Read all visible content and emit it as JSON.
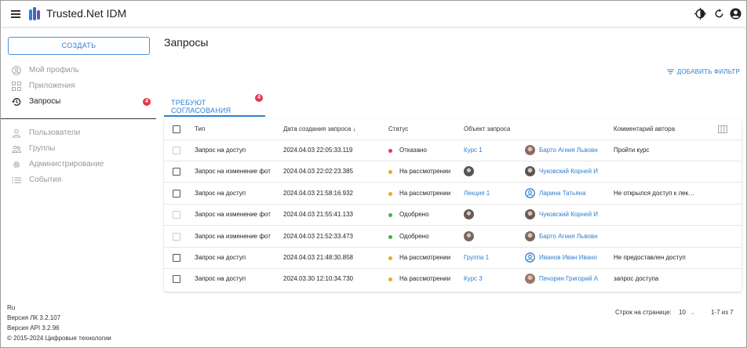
{
  "app": {
    "title": "Trusted.Net IDM"
  },
  "header": {
    "icons": [
      "contrast-icon",
      "refresh-icon",
      "account-icon"
    ]
  },
  "sidebar": {
    "create_label": "СОЗДАТЬ",
    "items": [
      {
        "label": "Мой профиль",
        "icon": "profile-icon"
      },
      {
        "label": "Приложения",
        "icon": "apps-icon"
      },
      {
        "label": "Запросы",
        "icon": "history-icon",
        "badge": "4",
        "active": true
      },
      {
        "label": "Пользователи",
        "icon": "user-icon"
      },
      {
        "label": "Группы",
        "icon": "group-icon"
      },
      {
        "label": "Администрирование",
        "icon": "gear-icon"
      },
      {
        "label": "События",
        "icon": "events-icon"
      }
    ],
    "footer": {
      "lang": "Ru",
      "version_lk": "Версия ЛК 3.2.107",
      "version_api": "Версия API 3.2.96",
      "copyright": "© 2015-2024 Цифровые технологии"
    }
  },
  "main": {
    "title": "Запросы",
    "add_filter_label": "ДОБАВИТЬ ФИЛЬТР",
    "tab": {
      "label": "ТРЕБУЮТ СОГЛАСОВАНИЯ",
      "badge": "4"
    },
    "columns": {
      "type": "Тип",
      "date": "Дата создания запроса ↓",
      "status": "Статус",
      "object": "Объект запроса",
      "comment": "Комментарий автора"
    },
    "rows": [
      {
        "type": "Запрос на доступ",
        "date": "2024.04.03 22:05:33.119",
        "status": "Отказано",
        "status_color": "#e53950",
        "object": "Курс 1",
        "user": "Барто Агния Львовн",
        "comment": "Пройти курс",
        "disabled": true,
        "obj_avatar": false,
        "user_avatar": "photo"
      },
      {
        "type": "Запрос на изменение фот",
        "date": "2024.04.03 22:02:23.385",
        "status": "На рассмотрении",
        "status_color": "#f5a623",
        "object": "",
        "user": "Чуковский Корней И",
        "comment": "",
        "disabled": false,
        "obj_avatar": true,
        "user_avatar": "photo"
      },
      {
        "type": "Запрос на доступ",
        "date": "2024.04.03 21:58:16.932",
        "status": "На рассмотрении",
        "status_color": "#f5a623",
        "object": "Лекция 1",
        "user": "Ларина Татьяна",
        "comment": "Не открылся доступ к лек…",
        "disabled": false,
        "obj_avatar": false,
        "user_avatar": "icon"
      },
      {
        "type": "Запрос на изменение фот",
        "date": "2024.04.03 21:55:41.133",
        "status": "Одобрено",
        "status_color": "#3cb44b",
        "object": "",
        "user": "Чуковский Корней И",
        "comment": "",
        "disabled": true,
        "obj_avatar": true,
        "user_avatar": "photo"
      },
      {
        "type": "Запрос на изменение фот",
        "date": "2024.04.03 21:52:33.473",
        "status": "Одобрено",
        "status_color": "#3cb44b",
        "object": "",
        "user": "Барто Агния Львовн",
        "comment": "",
        "disabled": true,
        "obj_avatar": true,
        "user_avatar": "photo"
      },
      {
        "type": "Запрос на доступ",
        "date": "2024.04.03 21:48:30.858",
        "status": "На рассмотрении",
        "status_color": "#f5a623",
        "object": "Группа 1",
        "user": "Иванов Иван Ивано",
        "comment": "Не предоставлен доступ",
        "disabled": false,
        "obj_avatar": false,
        "user_avatar": "icon"
      },
      {
        "type": "Запрос на доступ",
        "date": "2024.03.30 12:10:34.730",
        "status": "На рассмотрении",
        "status_color": "#f5a623",
        "object": "Курс 3",
        "user": "Печорин Григорий А",
        "comment": "запрос доступа",
        "disabled": false,
        "obj_avatar": false,
        "user_avatar": "photo"
      }
    ],
    "pagination": {
      "rows_per_page_label": "Строк на странице:",
      "rows_per_page": "10",
      "range": "1-7 из 7"
    }
  },
  "colors": {
    "accent": "#2f7fd1",
    "badge": "#e53950"
  }
}
